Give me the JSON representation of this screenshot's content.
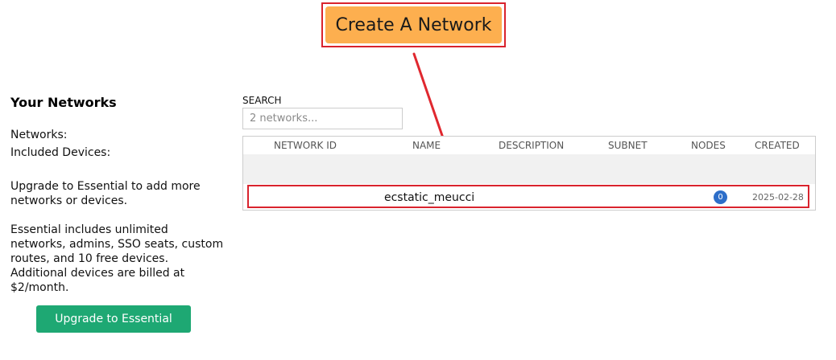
{
  "toolbar": {
    "create_network_label": "Create A Network"
  },
  "sidebar": {
    "title": "Your Networks",
    "networks_label": "Networks:",
    "devices_label": "Included Devices:",
    "upgrade_text": "Upgrade to Essential to add more networks or devices.",
    "essential_text": "Essential includes unlimited networks, admins, SSO seats, custom routes, and 10 free devices. Additional devices are billed at $2/month.",
    "upgrade_button_label": "Upgrade to Essential"
  },
  "search": {
    "label": "SEARCH",
    "placeholder": "2 networks..."
  },
  "table": {
    "columns": [
      "NETWORK ID",
      "NAME",
      "DESCRIPTION",
      "SUBNET",
      "NODES",
      "CREATED"
    ],
    "rows": [
      {
        "network_id": "",
        "name": "ecstatic_meucci",
        "description": "",
        "subnet": "",
        "nodes": "0",
        "created": "2025-02-28"
      }
    ]
  },
  "colors": {
    "create_button": "#fdaf4f",
    "upgrade_button": "#1ea873",
    "highlight": "#d9232d",
    "nodes_badge": "#2d6ec9"
  }
}
